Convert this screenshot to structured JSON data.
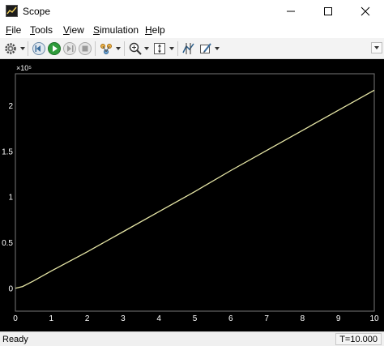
{
  "window": {
    "title": "Scope"
  },
  "menu": [
    {
      "pre": "",
      "key": "F",
      "rest": "ile"
    },
    {
      "pre": "",
      "key": "T",
      "rest": "ools"
    },
    {
      "pre": "",
      "key": "V",
      "rest": "iew"
    },
    {
      "pre": "",
      "key": "S",
      "rest": "imulation"
    },
    {
      "pre": "",
      "key": "H",
      "rest": "elp"
    }
  ],
  "toolbar": {
    "icons": [
      "settings-icon",
      "step-back-icon",
      "run-icon",
      "step-forward-icon",
      "stop-icon",
      "highlight-icon",
      "zoom-in-icon",
      "autoscale-icon",
      "cursor-measurements-icon",
      "style-icon"
    ]
  },
  "chart_data": {
    "type": "line",
    "title": "",
    "xlabel": "",
    "ylabel": "",
    "xlim": [
      0,
      10
    ],
    "ylim": [
      -0.25,
      2.35
    ],
    "y_exponent_label": "×10⁵",
    "xticks": [
      "0",
      "1",
      "2",
      "3",
      "4",
      "5",
      "6",
      "7",
      "8",
      "9",
      "10"
    ],
    "yticks": [
      "0",
      "0.5",
      "1",
      "1.5",
      "2"
    ],
    "grid": true,
    "colors": {
      "background": "#000000",
      "grid": "#444444",
      "axis_text": "#ffffff",
      "line": "#e6e6a6"
    },
    "series": [
      {
        "values_x": [
          0,
          0.2,
          0.5,
          1,
          2,
          3,
          4,
          5,
          6,
          7,
          8,
          9,
          10
        ],
        "values_y": [
          0,
          0.02,
          0.08,
          0.19,
          0.4,
          0.62,
          0.84,
          1.06,
          1.29,
          1.51,
          1.73,
          1.95,
          2.17
        ]
      }
    ]
  },
  "status": {
    "state": "Ready",
    "time": "T=10.000"
  }
}
